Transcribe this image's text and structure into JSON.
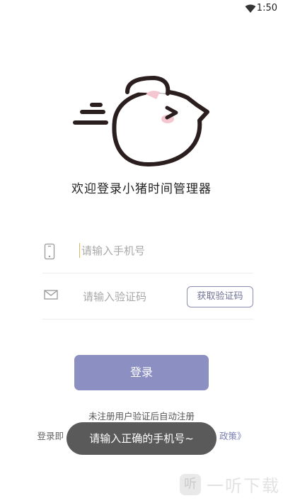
{
  "status_bar": {
    "time": "1:50",
    "wifi_icon": "wifi-icon"
  },
  "app": {
    "logo_icon": "flying-pig-logo",
    "welcome": "欢迎登录小猪时间管理器"
  },
  "form": {
    "phone": {
      "icon": "phone-icon",
      "placeholder": "请输入手机号"
    },
    "code": {
      "icon": "mail-icon",
      "placeholder": "请输入验证码",
      "get_code_label": "获取验证码"
    },
    "login_label": "登录"
  },
  "hint": "未注册用户验证后自动注册",
  "agreement": {
    "prefix": "登录即",
    "suffix": "政策》"
  },
  "toast": "请输入正确的手机号~",
  "watermark": {
    "icon_char": "听",
    "text": "一听下载"
  },
  "colors": {
    "accent": "#8b8fc1",
    "toast_bg": "#5a5a5a",
    "pig_pink": "#f4c6cf"
  }
}
